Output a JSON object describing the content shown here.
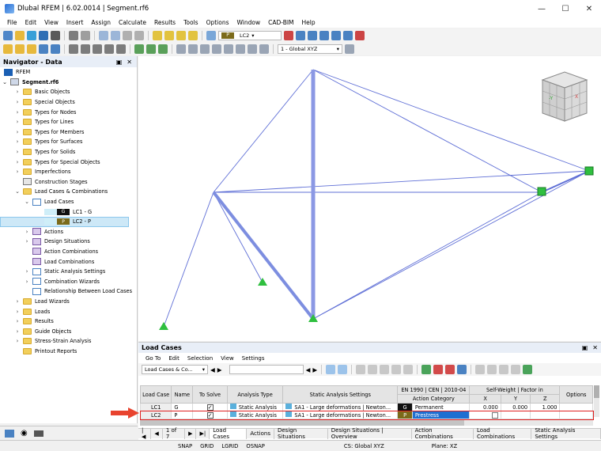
{
  "window": {
    "title": "Dlubal RFEM | 6.02.0014 | Segment.rf6"
  },
  "menu": [
    "File",
    "Edit",
    "View",
    "Insert",
    "Assign",
    "Calculate",
    "Results",
    "Tools",
    "Options",
    "Window",
    "CAD-BIM",
    "Help"
  ],
  "toolbar": {
    "lc_badge": "P",
    "lc_name": "LC2",
    "view_combo": "1 - Global XYZ"
  },
  "navigator": {
    "title": "Navigator - Data",
    "root": "RFEM",
    "model": "Segment.rf6",
    "items": [
      "Basic Objects",
      "Special Objects",
      "Types for Nodes",
      "Types for Lines",
      "Types for Members",
      "Types for Surfaces",
      "Types for Solids",
      "Types for Special Objects",
      "Imperfections",
      "Construction Stages",
      "Load Cases & Combinations"
    ],
    "load_cases_label": "Load Cases",
    "lc1": {
      "badge": "G",
      "label": "LC1 - G"
    },
    "lc2": {
      "badge": "P",
      "label": "LC2 - P"
    },
    "sub_items": [
      "Actions",
      "Design Situations",
      "Action Combinations",
      "Load Combinations",
      "Static Analysis Settings",
      "Combination Wizards",
      "Relationship Between Load Cases"
    ],
    "more_items": [
      "Load Wizards",
      "Loads",
      "Results",
      "Guide Objects",
      "Stress-Strain Analysis",
      "Printout Reports"
    ]
  },
  "viewcube": {
    "face_left": "-Y",
    "face_right": "X"
  },
  "panel": {
    "title": "Load Cases",
    "menu": [
      "Go To",
      "Edit",
      "Selection",
      "View",
      "Settings"
    ],
    "combo": "Load Cases & Co...",
    "headers": {
      "load_case": "Load Case",
      "name": "Name",
      "to_solve": "To Solve",
      "analysis_type": "Analysis Type",
      "static_settings": "Static Analysis Settings",
      "en_top": "EN 1990 | CEN | 2010-04",
      "action_category": "Action Category",
      "sw_top": "Self-Weight | Factor in",
      "x": "X",
      "y": "Y",
      "z": "Z",
      "options": "Options"
    },
    "rows": [
      {
        "lc": "LC1",
        "name": "G",
        "analysis": "Static Analysis",
        "settings": "SA1 - Large deformations | Newton...",
        "badge": "G",
        "category": "Permanent",
        "x": "0.000",
        "y": "0.000",
        "z": "1.000"
      },
      {
        "lc": "LC2",
        "name": "P",
        "analysis": "Static Analysis",
        "settings": "SA1 - Large deformations | Newton...",
        "badge": "P",
        "category": "Prestress",
        "x": "",
        "y": "",
        "z": ""
      }
    ],
    "pager": "1 of 7",
    "tabs": [
      "Load Cases",
      "Actions",
      "Design Situations",
      "Design Situations | Overview",
      "Action Combinations",
      "Load Combinations",
      "Static Analysis Settings"
    ]
  },
  "statusbar": [
    "SNAP",
    "GRID",
    "LGRID",
    "OSNAP",
    "CS: Global XYZ",
    "Plane: XZ"
  ]
}
